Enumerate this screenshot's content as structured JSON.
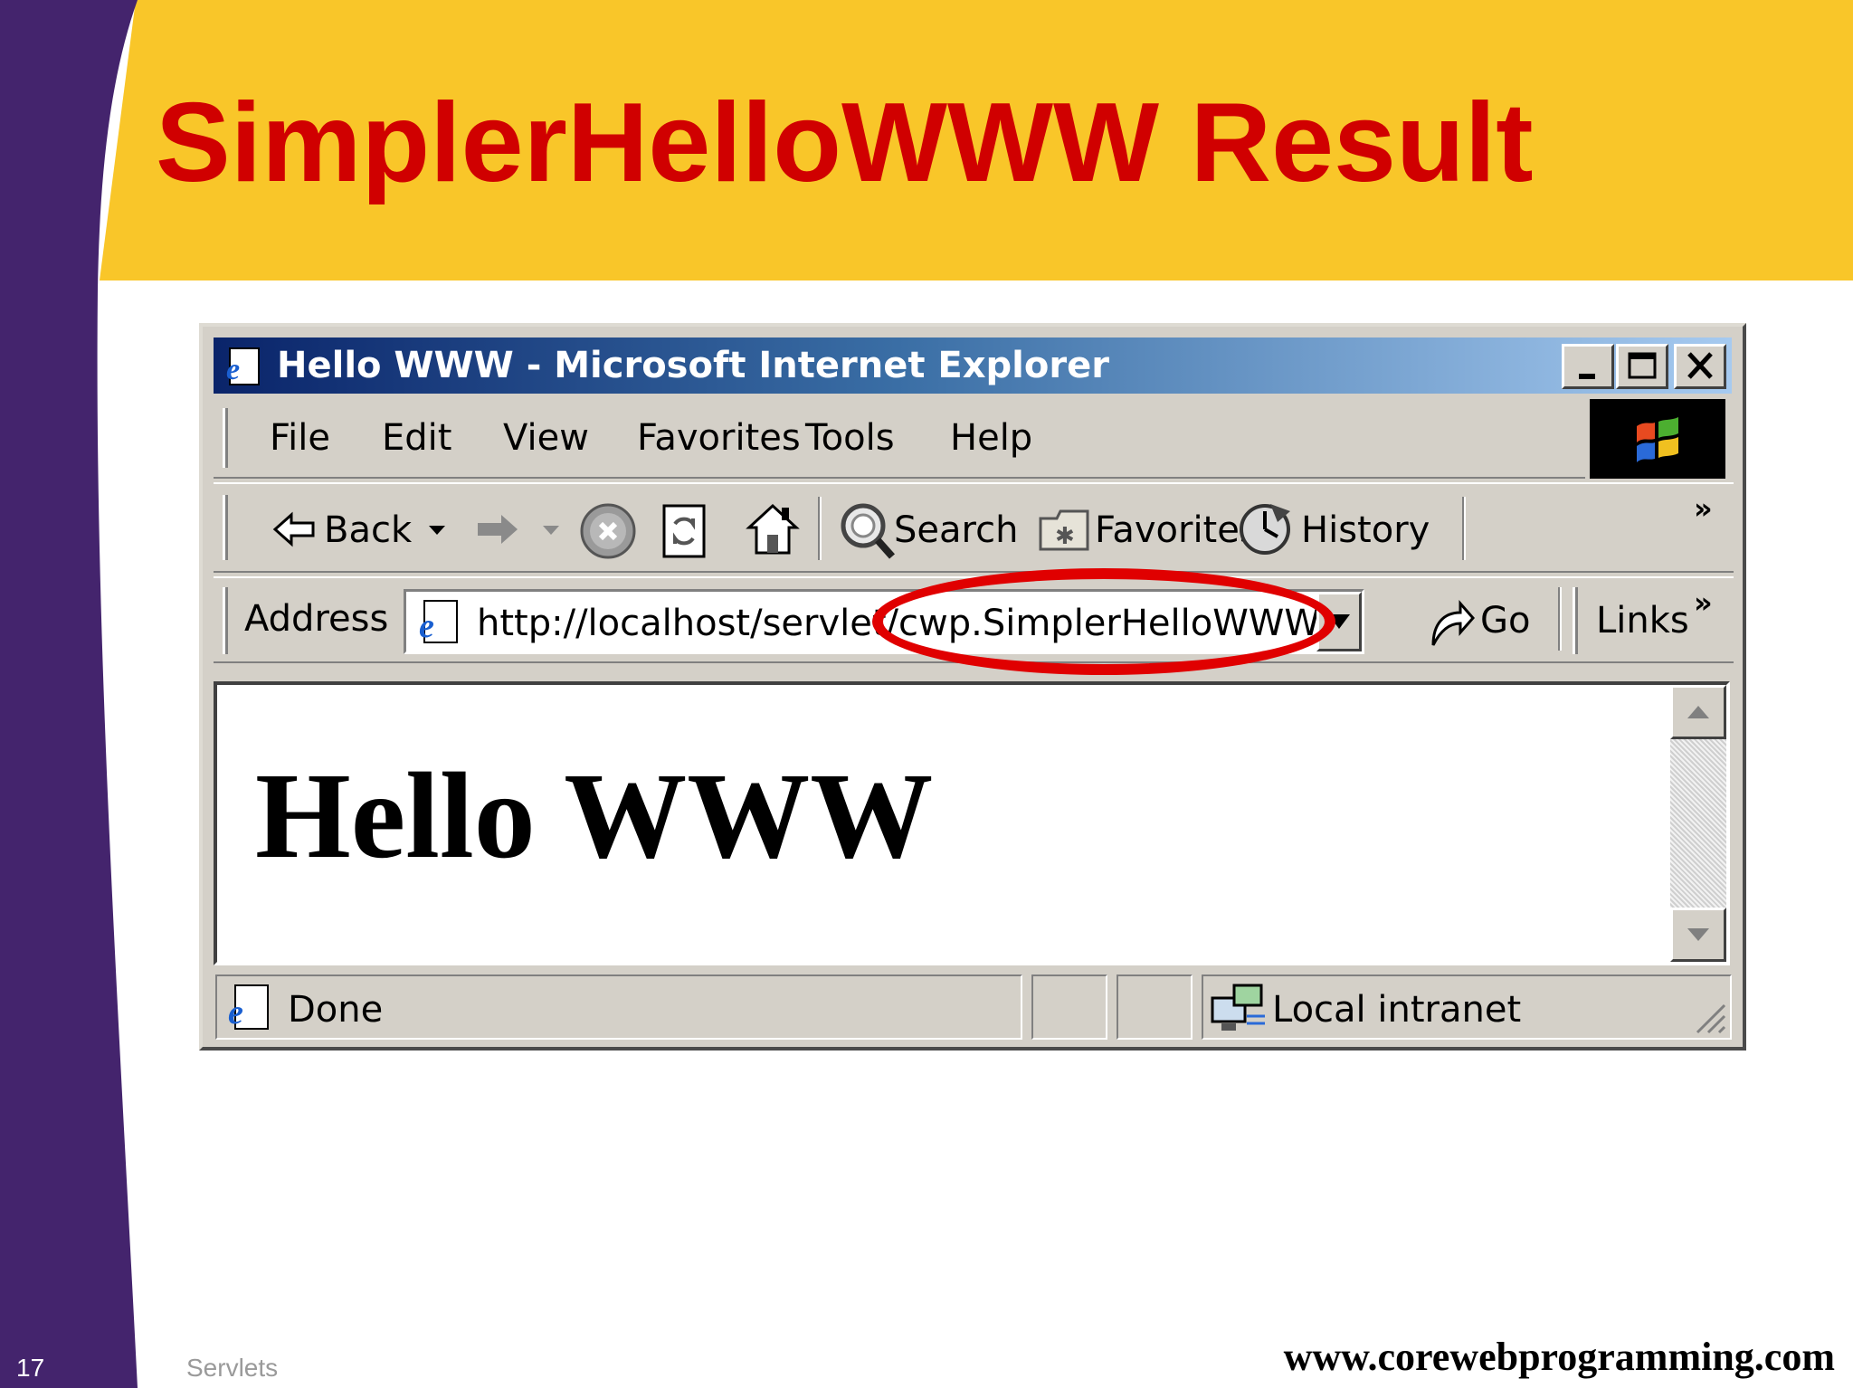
{
  "slide": {
    "title": "SimplerHelloWWW Result",
    "number": "17",
    "footer_left": "Servlets",
    "footer_url": "www.corewebprogramming.com"
  },
  "window": {
    "title": "Hello WWW - Microsoft Internet Explorer",
    "menu": [
      "File",
      "Edit",
      "View",
      "Favorites",
      "Tools",
      "Help"
    ],
    "toolbar": {
      "back": "Back",
      "search": "Search",
      "favorites": "Favorites",
      "history": "History"
    },
    "address": {
      "label": "Address",
      "url": "http://localhost/servlet/cwp.SimplerHelloWWW",
      "go": "Go",
      "links": "Links"
    },
    "content": {
      "heading": "Hello WWW"
    },
    "status": {
      "text": "Done",
      "zone": "Local intranet"
    }
  },
  "colors": {
    "title_red": "#d00000",
    "banner_yellow": "#f9c629",
    "side_purple": "#44246d",
    "highlight_red": "#e00000"
  },
  "icons": [
    "ie-page-icon",
    "minimize-icon",
    "maximize-icon",
    "close-icon",
    "windows-logo-icon",
    "back-arrow-icon",
    "forward-arrow-icon",
    "stop-icon",
    "refresh-icon",
    "home-icon",
    "search-icon",
    "favorites-icon",
    "history-icon",
    "go-arrow-icon",
    "intranet-icon"
  ]
}
